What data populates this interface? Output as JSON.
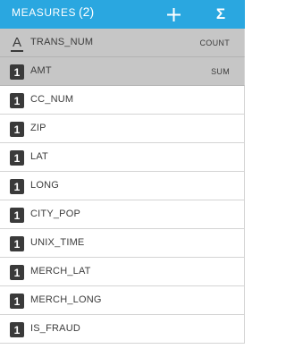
{
  "header": {
    "title": "MEASURES",
    "count": "(2)",
    "add_icon": "plus-icon",
    "sigma_label": "Σ",
    "bg_color": "#2aa7e0"
  },
  "fields": [
    {
      "icon": "A",
      "label": "TRANS_NUM",
      "agg": "COUNT",
      "selected": true
    },
    {
      "icon": "1",
      "label": "AMT",
      "agg": "SUM",
      "selected": true
    },
    {
      "icon": "1",
      "label": "CC_NUM",
      "agg": "",
      "selected": false
    },
    {
      "icon": "1",
      "label": "ZIP",
      "agg": "",
      "selected": false
    },
    {
      "icon": "1",
      "label": "LAT",
      "agg": "",
      "selected": false
    },
    {
      "icon": "1",
      "label": "LONG",
      "agg": "",
      "selected": false
    },
    {
      "icon": "1",
      "label": "CITY_POP",
      "agg": "",
      "selected": false
    },
    {
      "icon": "1",
      "label": "UNIX_TIME",
      "agg": "",
      "selected": false
    },
    {
      "icon": "1",
      "label": "MERCH_LAT",
      "agg": "",
      "selected": false
    },
    {
      "icon": "1",
      "label": "MERCH_LONG",
      "agg": "",
      "selected": false
    },
    {
      "icon": "1",
      "label": "IS_FRAUD",
      "agg": "",
      "selected": false
    }
  ]
}
